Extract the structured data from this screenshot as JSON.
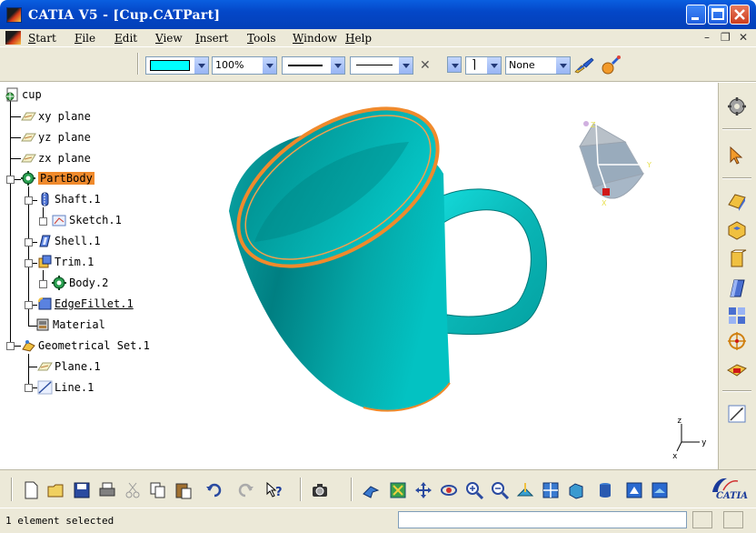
{
  "window": {
    "title": "CATIA V5 - [Cup.CATPart]"
  },
  "menu": {
    "start": "Start",
    "file": "File",
    "edit": "Edit",
    "view": "View",
    "insert": "Insert",
    "tools": "Tools",
    "window": "Window",
    "help": "Help"
  },
  "graphic_properties": {
    "fill_color": "#00ffff",
    "zoom": "100%",
    "layer": "None"
  },
  "tree": {
    "root": "cup",
    "xy_plane": "xy plane",
    "yz_plane": "yz plane",
    "zx_plane": "zx plane",
    "partbody": "PartBody",
    "shaft": "Shaft.1",
    "sketch": "Sketch.1",
    "shell": "Shell.1",
    "trim": "Trim.1",
    "body2": "Body.2",
    "edgefillet": "EdgeFillet.1",
    "material": "Material",
    "geoset": "Geometrical Set.1",
    "plane": "Plane.1",
    "line": "Line.1"
  },
  "compass": {
    "x": "X",
    "y": "Y",
    "z": "Z"
  },
  "axis": {
    "x": "x",
    "y": "y",
    "z": "z"
  },
  "colors": {
    "part_color": "#009e9e",
    "edge_highlight": "#f08a2c",
    "selection_highlight": "#f08a2c"
  },
  "logo": {
    "text": "CATIA"
  },
  "status": {
    "message": "1 element selected"
  }
}
